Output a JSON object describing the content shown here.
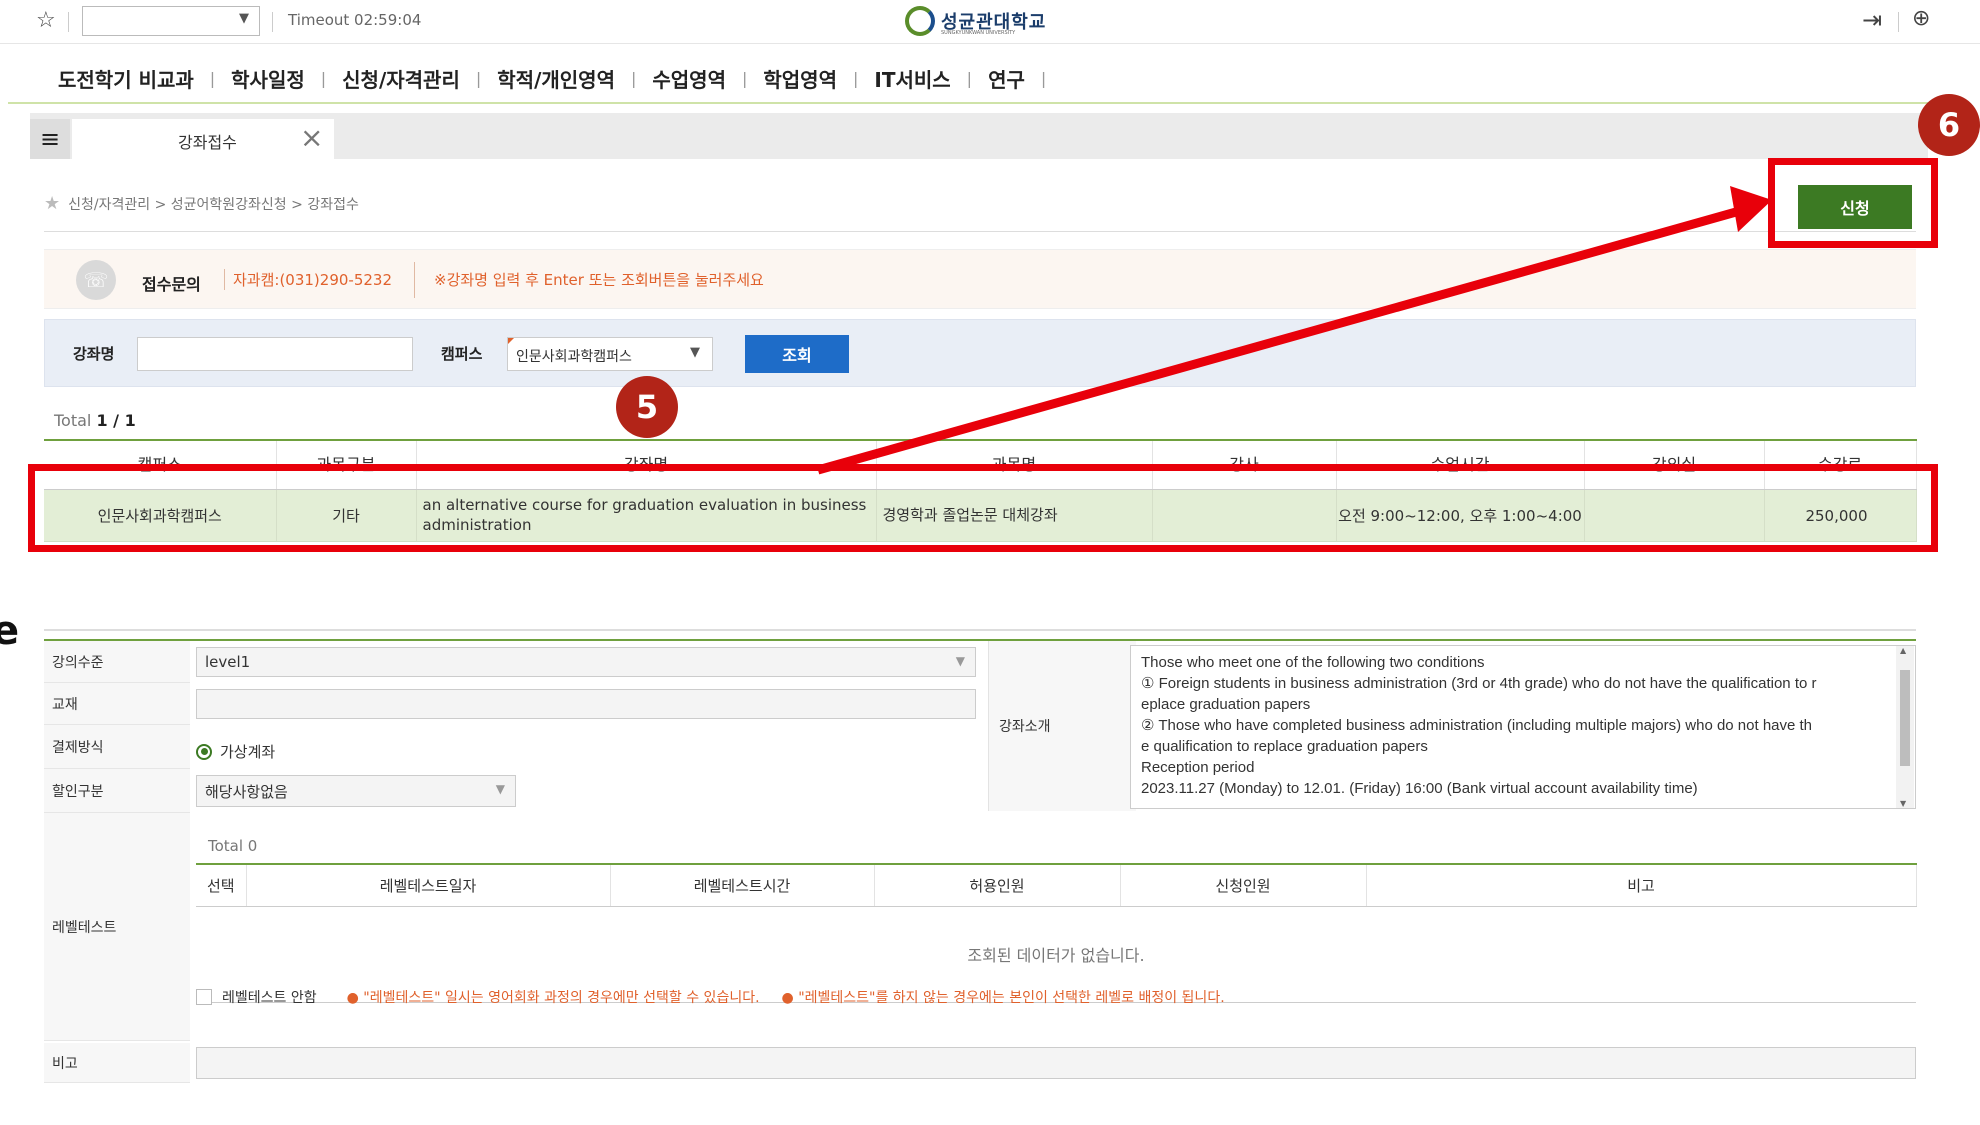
{
  "topbar": {
    "timeout": "Timeout 02:59:04",
    "logo_text": "성균관대학교",
    "logo_sub": "SUNGKYUNKWAN UNIVERSITY"
  },
  "menu": [
    "도전학기 비교과",
    "학사일정",
    "신청/자격관리",
    "학적/개인영역",
    "수업영역",
    "학업영역",
    "IT서비스",
    "연구"
  ],
  "tab": {
    "label": "강좌접수"
  },
  "breadcrumb": "신청/자격관리 > 성균어학원강좌신청 > 강좌접수",
  "apply_button": "신청",
  "notice": {
    "label": "접수문의",
    "phone": "자과캠:(031)290-5232",
    "message": "※강좌명 입력 후 Enter 또는 조회버튼을 눌러주세요"
  },
  "search": {
    "course_label": "강좌명",
    "course_value": "",
    "campus_label": "캠퍼스",
    "campus_value": "인문사회과학캠퍼스",
    "button": "조회"
  },
  "course_list": {
    "total_prefix": "Total ",
    "total_value": "1 / 1",
    "columns": [
      "캠퍼스",
      "과목구분",
      "강좌명",
      "과목명",
      "강사",
      "수업시간",
      "강의실",
      "수강료"
    ],
    "rows": [
      [
        "인문사회과학캠퍼스",
        "기타",
        "an alternative course for graduation evaluation in business administration",
        "경영학과 졸업논문 대체강좌",
        "",
        "오전 9:00~12:00, 오후 1:00~4:00",
        "",
        "250,000"
      ]
    ]
  },
  "detail": {
    "level_label": "강의수준",
    "level_value": "level1",
    "textbook_label": "교재",
    "textbook_value": "",
    "payment_label": "결제방식",
    "payment_value": "가상계좌",
    "discount_label": "할인구분",
    "discount_value": "해당사항없음",
    "intro_label": "강좌소개",
    "intro_lines": [
      "Those who meet one of the following two conditions",
      "① Foreign students in business administration (3rd or 4th grade) who do not have the qualification to r",
      "eplace graduation papers",
      "② Those who have completed business administration (including multiple majors) who do not have th",
      "e qualification to replace graduation papers",
      "Reception period",
      "2023.11.27 (Monday) to 12.01. (Friday) 16:00 (Bank virtual account availability time)"
    ],
    "leveltest_label": "레벨테스트",
    "leveltest_total": "Total 0",
    "leveltest_columns": [
      "선택",
      "레벨테스트일자",
      "레벨테스트시간",
      "허용인원",
      "신청인원",
      "비고"
    ],
    "leveltest_empty": "조회된 데이터가 없습니다.",
    "leveltest_skip": "레벨테스트 안함",
    "warn1": "● \"레벨테스트\" 일시는 영어회화 과정의 경우에만 선택할 수 있습니다.",
    "warn2": "● \"레벨테스트\"를 하지 않는 경우에는 본인이 선택한 레벨로 배정이 됩니다.",
    "remarks_label": "비고"
  },
  "annotations": {
    "badge5": "5",
    "badge6": "6",
    "edge_glyph": "e"
  },
  "colors": {
    "highlight": "#e8000a",
    "badge": "#b22418",
    "green": "#3c7a23",
    "blue": "#1e6cc8",
    "orange": "#e0612c"
  }
}
